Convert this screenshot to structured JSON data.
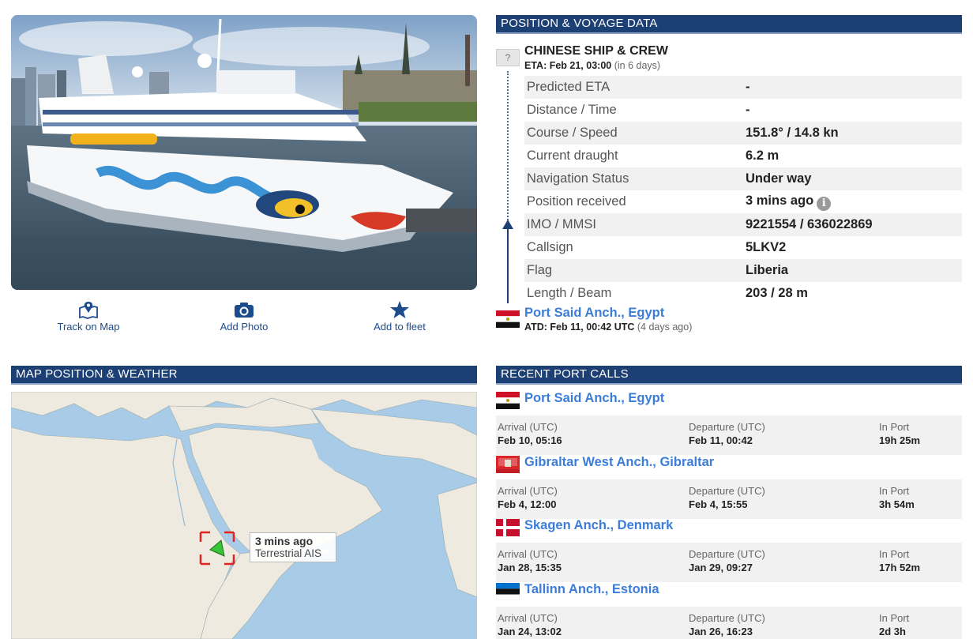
{
  "actions": {
    "track": "Track on Map",
    "photo": "Add Photo",
    "fleet": "Add to fleet"
  },
  "voyage": {
    "header": "POSITION & VOYAGE DATA",
    "dest_box": "?",
    "destination": "CHINESE SHIP & CREW",
    "eta_prefix": "ETA: Feb 21, 03:00",
    "eta_rel": "(in 6 days)",
    "rows": [
      {
        "k": "Predicted ETA",
        "v": "-"
      },
      {
        "k": "Distance / Time",
        "v": "-"
      },
      {
        "k": "Course / Speed",
        "v": "151.8° / 14.8 kn"
      },
      {
        "k": "Current draught",
        "v": "6.2 m"
      },
      {
        "k": "Navigation Status",
        "v": "Under way"
      },
      {
        "k": "Position received",
        "v": "3 mins ago"
      },
      {
        "k": "IMO / MMSI",
        "v": "9221554 / 636022869"
      },
      {
        "k": "Callsign",
        "v": "5LKV2"
      },
      {
        "k": "Flag",
        "v": "Liberia"
      },
      {
        "k": "Length / Beam",
        "v": "203 / 28 m"
      }
    ],
    "info_icon": "i",
    "from_port": "Port Said Anch., Egypt",
    "atd_prefix": "ATD: Feb 11, 00:42 UTC",
    "atd_rel": "(4 days ago)"
  },
  "map": {
    "header": "MAP POSITION & WEATHER",
    "label_time": "3 mins ago",
    "label_source": "Terrestrial AIS"
  },
  "port_calls": {
    "header": "RECENT PORT CALLS",
    "arrival_label": "Arrival (UTC)",
    "departure_label": "Departure (UTC)",
    "inport_label": "In Port",
    "items": [
      {
        "port": "Port Said Anch., Egypt",
        "flag": "egypt",
        "arrival": "Feb 10, 05:16",
        "departure": "Feb 11, 00:42",
        "in_port": "19h 25m"
      },
      {
        "port": "Gibraltar West Anch., Gibraltar",
        "flag": "gibraltar",
        "arrival": "Feb 4, 12:00",
        "departure": "Feb 4, 15:55",
        "in_port": "3h 54m"
      },
      {
        "port": "Skagen Anch., Denmark",
        "flag": "denmark",
        "arrival": "Jan 28, 15:35",
        "departure": "Jan 29, 09:27",
        "in_port": "17h 52m"
      },
      {
        "port": "Tallinn Anch., Estonia",
        "flag": "estonia",
        "arrival": "Jan 24, 13:02",
        "departure": "Jan 26, 16:23",
        "in_port": "2d 3h"
      }
    ]
  },
  "colors": {
    "header_bg": "#1c3f74",
    "link": "#3b7dd8",
    "stripe": "#f1f1f1"
  }
}
